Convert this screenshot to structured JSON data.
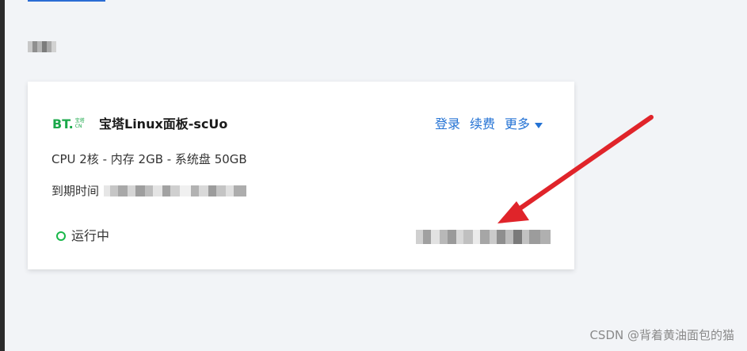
{
  "card": {
    "logo_text": "BT.",
    "logo_small_top": "宝塔",
    "logo_small_bottom": "CN",
    "title": "宝塔Linux面板-scUo",
    "actions": {
      "login": "登录",
      "renew": "续费",
      "more": "更多"
    },
    "specs": "CPU 2核 - 内存 2GB - 系统盘 50GB",
    "expiry_label": "到期时间",
    "status": "运行中"
  },
  "watermark": "CSDN @背着黄油面包的猫",
  "colors": {
    "accent": "#2372d4",
    "status_running": "#19b84a",
    "logo_green": "#1aa84a",
    "arrow_red": "#e0242a"
  },
  "icons": {
    "more_caret": "caret-down-icon",
    "status": "status-ring-icon",
    "annotation": "red-arrow-icon"
  }
}
